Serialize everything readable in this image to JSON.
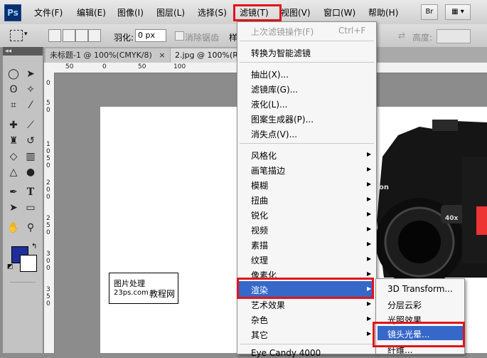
{
  "app": {
    "logo": "Ps"
  },
  "menubar": {
    "items": [
      "文件(F)",
      "编辑(E)",
      "图像(I)",
      "图层(L)",
      "选择(S)",
      "滤镜(T)",
      "视图(V)",
      "窗口(W)",
      "帮助(H)"
    ],
    "bridge_label": "Br"
  },
  "options": {
    "feather_label": "羽化:",
    "feather_value": "0 px",
    "antialias_label": "消除锯齿",
    "style_partial": "样",
    "height_label": "高度:"
  },
  "tabs": [
    {
      "label": "未标题-1 @ 100%(CMYK/8)",
      "close": "×"
    },
    {
      "label": "2.jpg @ 100%(R"
    }
  ],
  "ruler": {
    "h": [
      "50",
      "0",
      "50",
      "100"
    ],
    "v": [
      "0",
      "5",
      "0",
      "1",
      "0",
      "5",
      "0",
      "2",
      "0",
      "0",
      "2",
      "5",
      "0",
      "3",
      "0",
      "0",
      "3",
      "5",
      "0"
    ]
  },
  "watermark": {
    "line1": "图片处理",
    "line2a": "23ps.com",
    "line2b": "教程网"
  },
  "camera": {
    "badge": "40x",
    "brand_partial": "on"
  },
  "filter_menu": {
    "last_filter": "上次滤镜操作(F)",
    "last_shortcut": "Ctrl+F",
    "smart": "转换为智能滤镜",
    "group1": [
      "抽出(X)...",
      "滤镜库(G)...",
      "液化(L)...",
      "图案生成器(P)...",
      "消失点(V)..."
    ],
    "group2": [
      "风格化",
      "画笔描边",
      "模糊",
      "扭曲",
      "锐化",
      "视频",
      "素描",
      "纹理",
      "像素化",
      "渲染",
      "艺术效果",
      "杂色",
      "其它"
    ],
    "partial_bottom": "Eye Candy 4000"
  },
  "render_submenu": [
    "3D Transform...",
    "分层云彩",
    "光照效果...",
    "镜头光晕...",
    "纤维..."
  ],
  "colors": {
    "highlight": "#3568c9",
    "annotation": "#e0151b",
    "foreground": "#1f2f9a",
    "background": "#ffffff"
  }
}
